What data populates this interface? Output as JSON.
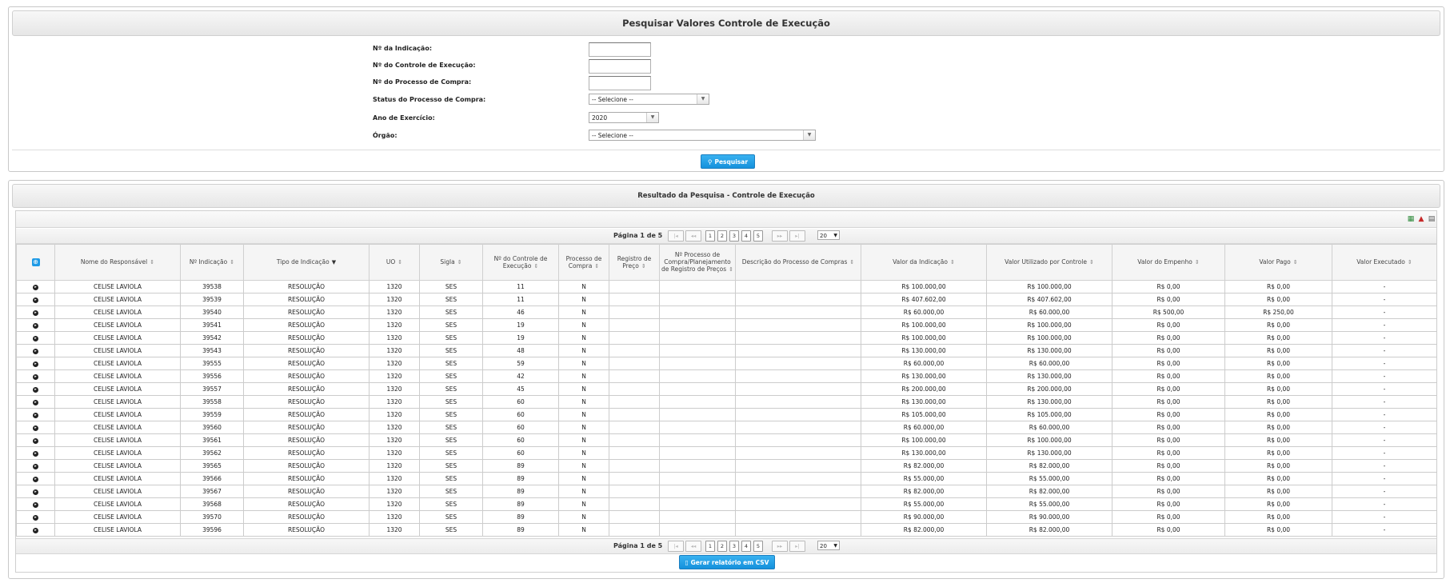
{
  "search": {
    "title": "Pesquisar Valores Controle de Execução",
    "fields": {
      "indicacao_label": "Nº da Indicação:",
      "indicacao_value": "",
      "controle_label": "Nº do Controle de Execução:",
      "controle_value": "",
      "processo_label": "Nº do Processo de Compra:",
      "processo_value": "",
      "status_label": "Status do Processo de Compra:",
      "status_value": "-- Selecione --",
      "ano_label": "Ano de Exercício:",
      "ano_value": "2020",
      "orgao_label": "Órgão:",
      "orgao_value": "-- Selecione --"
    },
    "button_label": "Pesquisar",
    "accent_color": "#1591dc"
  },
  "results": {
    "title": "Resultado da Pesquisa - Controle de Execução",
    "pager": {
      "label": "Página 1 de 5",
      "first": "|◂",
      "prev": "◂◂",
      "pages": [
        "1",
        "2",
        "3",
        "4",
        "5"
      ],
      "next": "▸▸",
      "last": "▸|",
      "page_size": "20"
    },
    "columns": [
      "Nome do Responsável",
      "Nº Indicação",
      "Tipo de Indicação",
      "UO",
      "Sigla",
      "Nº do Controle de Execução",
      "Processo de Compra",
      "Registro de Preço",
      "Nº Processo de Compra/Planejamento de Registro de Preços",
      "Descrição do Processo de Compras",
      "Valor da Indicação",
      "Valor Utilizado por Controle",
      "Valor do Empenho",
      "Valor Pago",
      "Valor Executado"
    ],
    "rows": [
      [
        "CELISE LAVIOLA",
        "39538",
        "RESOLUÇÃO",
        "1320",
        "SES",
        "11",
        "N",
        "",
        "",
        "",
        "R$ 100.000,00",
        "R$ 100.000,00",
        "R$ 0,00",
        "R$ 0,00",
        "-"
      ],
      [
        "CELISE LAVIOLA",
        "39539",
        "RESOLUÇÃO",
        "1320",
        "SES",
        "11",
        "N",
        "",
        "",
        "",
        "R$ 407.602,00",
        "R$ 407.602,00",
        "R$ 0,00",
        "R$ 0,00",
        "-"
      ],
      [
        "CELISE LAVIOLA",
        "39540",
        "RESOLUÇÃO",
        "1320",
        "SES",
        "46",
        "N",
        "",
        "",
        "",
        "R$ 60.000,00",
        "R$ 60.000,00",
        "R$ 500,00",
        "R$ 250,00",
        "-"
      ],
      [
        "CELISE LAVIOLA",
        "39541",
        "RESOLUÇÃO",
        "1320",
        "SES",
        "19",
        "N",
        "",
        "",
        "",
        "R$ 100.000,00",
        "R$ 100.000,00",
        "R$ 0,00",
        "R$ 0,00",
        "-"
      ],
      [
        "CELISE LAVIOLA",
        "39542",
        "RESOLUÇÃO",
        "1320",
        "SES",
        "19",
        "N",
        "",
        "",
        "",
        "R$ 100.000,00",
        "R$ 100.000,00",
        "R$ 0,00",
        "R$ 0,00",
        "-"
      ],
      [
        "CELISE LAVIOLA",
        "39543",
        "RESOLUÇÃO",
        "1320",
        "SES",
        "48",
        "N",
        "",
        "",
        "",
        "R$ 130.000,00",
        "R$ 130.000,00",
        "R$ 0,00",
        "R$ 0,00",
        "-"
      ],
      [
        "CELISE LAVIOLA",
        "39555",
        "RESOLUÇÃO",
        "1320",
        "SES",
        "59",
        "N",
        "",
        "",
        "",
        "R$ 60.000,00",
        "R$ 60.000,00",
        "R$ 0,00",
        "R$ 0,00",
        "-"
      ],
      [
        "CELISE LAVIOLA",
        "39556",
        "RESOLUÇÃO",
        "1320",
        "SES",
        "42",
        "N",
        "",
        "",
        "",
        "R$ 130.000,00",
        "R$ 130.000,00",
        "R$ 0,00",
        "R$ 0,00",
        "-"
      ],
      [
        "CELISE LAVIOLA",
        "39557",
        "RESOLUÇÃO",
        "1320",
        "SES",
        "45",
        "N",
        "",
        "",
        "",
        "R$ 200.000,00",
        "R$ 200.000,00",
        "R$ 0,00",
        "R$ 0,00",
        "-"
      ],
      [
        "CELISE LAVIOLA",
        "39558",
        "RESOLUÇÃO",
        "1320",
        "SES",
        "60",
        "N",
        "",
        "",
        "",
        "R$ 130.000,00",
        "R$ 130.000,00",
        "R$ 0,00",
        "R$ 0,00",
        "-"
      ],
      [
        "CELISE LAVIOLA",
        "39559",
        "RESOLUÇÃO",
        "1320",
        "SES",
        "60",
        "N",
        "",
        "",
        "",
        "R$ 105.000,00",
        "R$ 105.000,00",
        "R$ 0,00",
        "R$ 0,00",
        "-"
      ],
      [
        "CELISE LAVIOLA",
        "39560",
        "RESOLUÇÃO",
        "1320",
        "SES",
        "60",
        "N",
        "",
        "",
        "",
        "R$ 60.000,00",
        "R$ 60.000,00",
        "R$ 0,00",
        "R$ 0,00",
        "-"
      ],
      [
        "CELISE LAVIOLA",
        "39561",
        "RESOLUÇÃO",
        "1320",
        "SES",
        "60",
        "N",
        "",
        "",
        "",
        "R$ 100.000,00",
        "R$ 100.000,00",
        "R$ 0,00",
        "R$ 0,00",
        "-"
      ],
      [
        "CELISE LAVIOLA",
        "39562",
        "RESOLUÇÃO",
        "1320",
        "SES",
        "60",
        "N",
        "",
        "",
        "",
        "R$ 130.000,00",
        "R$ 130.000,00",
        "R$ 0,00",
        "R$ 0,00",
        "-"
      ],
      [
        "CELISE LAVIOLA",
        "39565",
        "RESOLUÇÃO",
        "1320",
        "SES",
        "89",
        "N",
        "",
        "",
        "",
        "R$ 82.000,00",
        "R$ 82.000,00",
        "R$ 0,00",
        "R$ 0,00",
        "-"
      ],
      [
        "CELISE LAVIOLA",
        "39566",
        "RESOLUÇÃO",
        "1320",
        "SES",
        "89",
        "N",
        "",
        "",
        "",
        "R$ 55.000,00",
        "R$ 55.000,00",
        "R$ 0,00",
        "R$ 0,00",
        "-"
      ],
      [
        "CELISE LAVIOLA",
        "39567",
        "RESOLUÇÃO",
        "1320",
        "SES",
        "89",
        "N",
        "",
        "",
        "",
        "R$ 82.000,00",
        "R$ 82.000,00",
        "R$ 0,00",
        "R$ 0,00",
        "-"
      ],
      [
        "CELISE LAVIOLA",
        "39568",
        "RESOLUÇÃO",
        "1320",
        "SES",
        "89",
        "N",
        "",
        "",
        "",
        "R$ 55.000,00",
        "R$ 55.000,00",
        "R$ 0,00",
        "R$ 0,00",
        "-"
      ],
      [
        "CELISE LAVIOLA",
        "39570",
        "RESOLUÇÃO",
        "1320",
        "SES",
        "89",
        "N",
        "",
        "",
        "",
        "R$ 90.000,00",
        "R$ 90.000,00",
        "R$ 0,00",
        "R$ 0,00",
        "-"
      ],
      [
        "CELISE LAVIOLA",
        "39596",
        "RESOLUÇÃO",
        "1320",
        "SES",
        "89",
        "N",
        "",
        "",
        "",
        "R$ 82.000,00",
        "R$ 82.000,00",
        "R$ 0,00",
        "R$ 0,00",
        "-"
      ]
    ],
    "csv_button_label": "Gerar relatório em CSV",
    "icons": [
      "excel-export-icon",
      "pdf-export-icon",
      "print-icon"
    ]
  }
}
